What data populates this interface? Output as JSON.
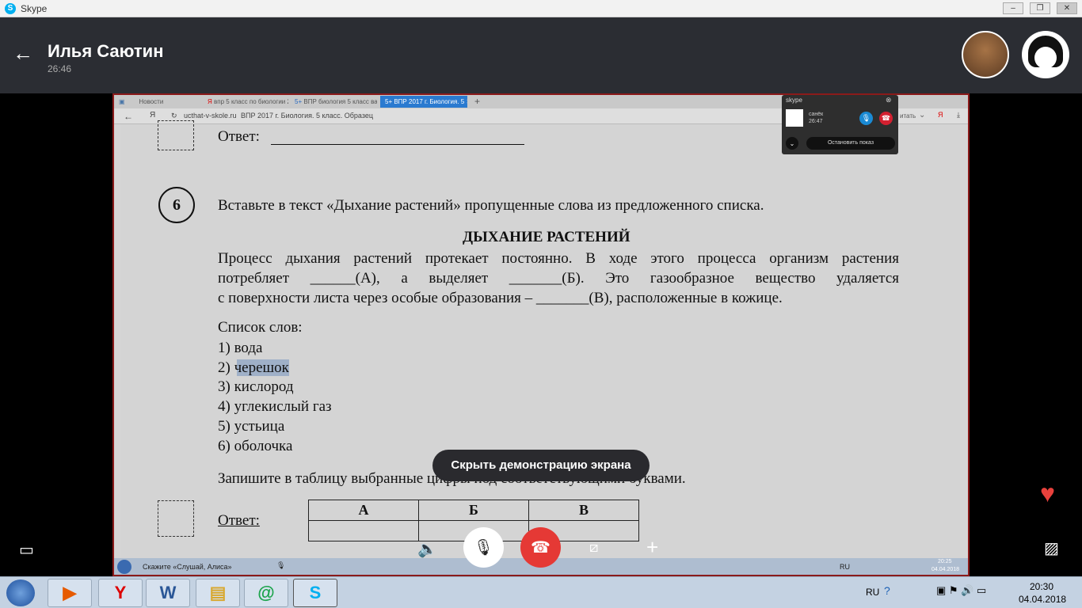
{
  "app": {
    "title": "Skype"
  },
  "call": {
    "contact_name": "Илья Саютин",
    "duration": "26:46"
  },
  "browser": {
    "tabs": [
      {
        "label": "Новости"
      },
      {
        "label": "впр 5 класс по биологии 2("
      },
      {
        "label": "ВПР биология 5 класс вари"
      },
      {
        "label": "ВПР 2017 г. Биология. 5"
      }
    ],
    "url_domain": "ucthat-v-skole.ru",
    "page_title": "ВПР 2017 г. Биология. 5 класс. Образец"
  },
  "mini_skype": {
    "contact": "санёк",
    "duration": "26:47",
    "stop_label": "Остановить показ",
    "partial_text": "итать"
  },
  "document": {
    "prev_answer_label": "Ответ:",
    "task_number": "6",
    "task_text": "Вставьте в текст «Дыхание растений» пропущенные слова из предложенного списка.",
    "heading": "ДЫХАНИЕ РАСТЕНИЙ",
    "paragraph": [
      "Процесс дыхания растений протекает постоянно. В ходе этого процесса организм растения",
      "потребляет ______(А), а выделяет _______(Б). Это газообразное вещество удаляется",
      "с поверхности листа через особые образования – _______(В), расположенные в кожице."
    ],
    "list_title": "Список слов:",
    "words": [
      "1) вода",
      "2) черешок",
      "3) кислород",
      "4) углекислый газ",
      "5) устьица",
      "6) оболочка"
    ],
    "instruction": "Запишите в таблицу выбранные цифры под соответствующими буквами.",
    "answer_label": "Ответ:",
    "table_headers": [
      "А",
      "Б",
      "В"
    ]
  },
  "hide_share_label": "Скрыть демонстрацию экрана",
  "remote_taskbar": {
    "search": "Скажите «Слушай, Алиса»",
    "lang": "RU",
    "time": "20:25",
    "date": "04.04.2018"
  },
  "taskbar": {
    "lang": "RU",
    "time": "20:30",
    "date": "04.04.2018"
  },
  "colors": {
    "end_call": "#e53935",
    "header": "#2b2d33",
    "heart": "#e8413c"
  }
}
